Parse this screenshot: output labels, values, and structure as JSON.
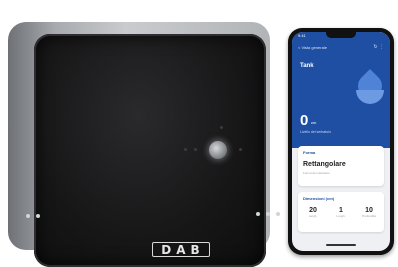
{
  "device": {
    "logo_text": "DAB",
    "colors": {
      "face": "#161617",
      "side": "#b1b4b7",
      "logo": "#e6e6e6"
    }
  },
  "phone_app": {
    "status_time": "9:41",
    "nav_back": "< Vista generale",
    "nav_icons": "↻ ⋮",
    "tank_title": "Tank",
    "level_value": "0",
    "level_unit": "cm",
    "level_caption": "Livello del serbatoio",
    "shape_card": {
      "label": "Forma",
      "value": "Rettangolare",
      "sub": "Forma del serbatoio"
    },
    "dims_card": {
      "label": "Dimensioni (cm)",
      "items": [
        {
          "value": "20",
          "label": "Largh."
        },
        {
          "value": "1",
          "label": "Lungh."
        },
        {
          "value": "10",
          "label": "Profondità"
        }
      ]
    },
    "colors": {
      "header": "#1f4fa3",
      "accent": "#4f83d8",
      "background": "#eef0f4"
    }
  },
  "icons": [
    "drop-icon",
    "refresh-icon",
    "menu-icon"
  ]
}
